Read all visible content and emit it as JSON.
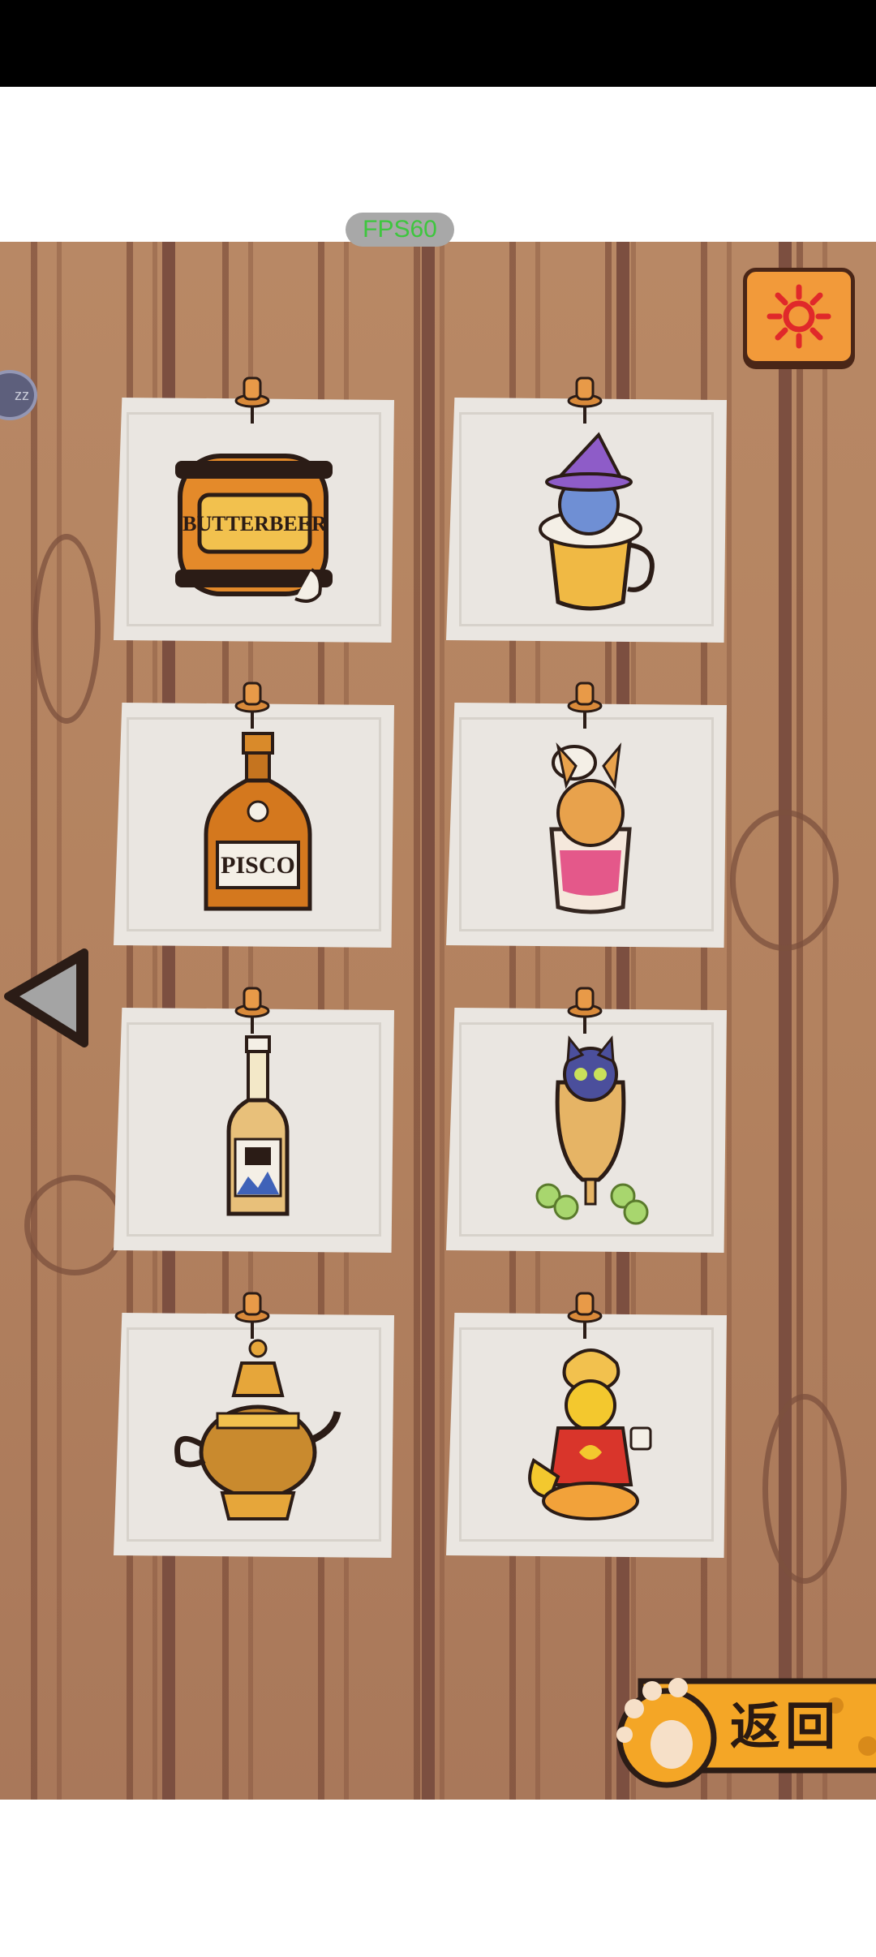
{
  "status_bar": {},
  "fps": {
    "label": "FPS60"
  },
  "side_circle": {
    "label": "zz"
  },
  "settings": {
    "icon": "gear-icon"
  },
  "items": [
    {
      "name": "butterbeer-barrel",
      "text": "BUTTERBEER"
    },
    {
      "name": "wizard-cat-mug",
      "text": ""
    },
    {
      "name": "pisco-bottle",
      "text": "PISCO"
    },
    {
      "name": "llama-cat-glass",
      "text": ""
    },
    {
      "name": "clear-liquor-bottle",
      "text": ""
    },
    {
      "name": "grape-cat-glass",
      "text": ""
    },
    {
      "name": "golden-teapot",
      "text": ""
    },
    {
      "name": "genie-cat-lamp",
      "text": ""
    }
  ],
  "nav": {
    "back_icon": "triangle-left-icon"
  },
  "return_button": {
    "label": "返回",
    "icon": "paw-icon"
  },
  "colors": {
    "accent": "#f29a3a",
    "wood": "#b88865",
    "paper": "#eae6e1",
    "fps_text": "#3ec63e"
  }
}
